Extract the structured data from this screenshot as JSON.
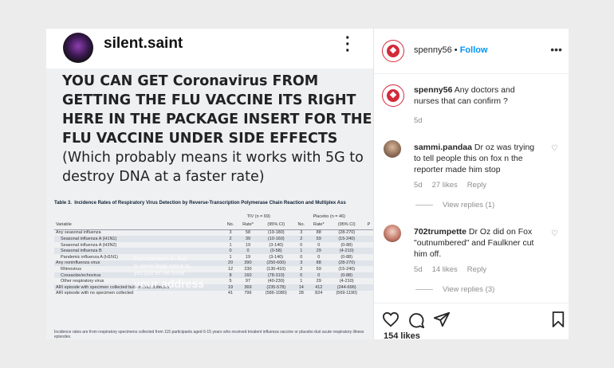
{
  "post_image": {
    "username": "silent.saint",
    "avatar_text": "",
    "headline_caps": "YOU CAN GET Coronavirus FROM GETTING THE FLU VACCINE ITS RIGHT HERE IN THE PACKAGE INSERT FOR THE FLU VACCINE UNDER SIDE EFFECTS",
    "headline_sub": "(Which probably means it works with 5G to destroy DNA at a faster rate)",
    "table_title_prefix": "Table 3.",
    "table_title": "Incidence Rates of Respiratory Virus Detection by Reverse-Transcription Polymerase Chain Reaction and Multiplex Ass",
    "group_headers": [
      "TIV (n = 69)",
      "Placebo (n = 46)"
    ],
    "columns": [
      "Variable",
      "No.",
      "Rate*",
      "(95% CI)",
      "No.",
      "Rate*",
      "(95% CI)",
      "P"
    ],
    "rows": [
      [
        "Any seasonal influenza",
        "3",
        "58",
        "(19-180)",
        "3",
        "88",
        "(28-270)",
        ""
      ],
      [
        "Seasonal influenza A (H1N1)",
        "2",
        "39",
        "(10-160)",
        "2",
        "59",
        "(15-240)",
        ""
      ],
      [
        "Seasonal influenza A (H3N2)",
        "1",
        "19",
        "(3-140)",
        "0",
        "0",
        "(0-88)",
        ""
      ],
      [
        "Seasonal influenza B",
        "0",
        "0",
        "(0-58)",
        "1",
        "29",
        "(4-210)",
        ""
      ],
      [
        "Pandemic influenza A (H1N1)",
        "1",
        "19",
        "(3-140)",
        "0",
        "0",
        "(0-88)",
        ""
      ],
      [
        "Any noninfluenza virus",
        "20",
        "390",
        "(250-600)",
        "3",
        "88",
        "(28-270)",
        ""
      ],
      [
        "Rhinovirus",
        "12",
        "230",
        "(130-410)",
        "2",
        "59",
        "(15-240)",
        ""
      ],
      [
        "Coxsackie/echovirus",
        "8",
        "160",
        "(78-310)",
        "0",
        "0",
        "(0-88)",
        ""
      ],
      [
        "Other respiratory virus",
        "5",
        "97",
        "(40-230)",
        "1",
        "29",
        "(4-210)",
        ""
      ],
      [
        "ARI episode with specimen collected but no virus detected",
        "19",
        "369",
        "(235-578)",
        "14",
        "412",
        "(244-696)",
        ""
      ],
      [
        "ARI episode with no specimen collected",
        "41",
        "796",
        "(586-1080)",
        "28",
        "824",
        "(569-1190)",
        ""
      ]
    ],
    "overlay_line1": "Fact checkers if i kno",
    "overlay_line2": "to serve legal notice to",
    "overlay_line3": "you just let me know",
    "overlay_big": "your address",
    "footnote": "Incidence rates are from respiratory specimens collected from 115 participants aged 6-15 years who received trivalent influenza vaccine or placebo duri acute respiratory illness episodes."
  },
  "panel": {
    "owner": "spenny56",
    "follow_separator": "•",
    "follow_label": "Follow",
    "menu_label": "•••",
    "caption_user": "spenny56",
    "caption_text": "Any doctors and nurses that can confirm ?",
    "caption_age": "5d",
    "comments": [
      {
        "user": "sammi.pandaa",
        "text": "Dr oz was trying to tell people this on fox n the reporter made him stop",
        "age": "5d",
        "likes": "27 likes",
        "reply": "Reply",
        "view_replies": "View replies (1)"
      },
      {
        "user": "702trumpette",
        "text": "Dr Oz did on Fox \"outnumbered\" and Faulkner cut him off.",
        "age": "5d",
        "likes": "14 likes",
        "reply": "Reply",
        "view_replies": "View replies (3)"
      }
    ],
    "likes_total": "154 likes",
    "colors": {
      "accent": "#0095f6",
      "logo_red": "#d32a3a"
    }
  }
}
